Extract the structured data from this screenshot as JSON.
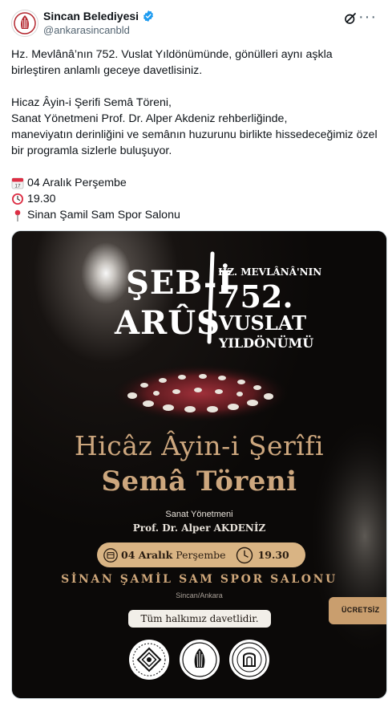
{
  "account": {
    "name": "Sincan Belediyesi",
    "handle": "@ankarasincanbld",
    "verified": true
  },
  "header_icons": [
    "verified-badge-icon",
    "grok-icon",
    "more-icon"
  ],
  "tweet": {
    "paragraph1": [
      "Hz. Mevlânâ’nın 752. Vuslat Yıldönümünde, gönülleri aynı aşkla",
      "birleştiren anlamlı geceye davetlisiniz."
    ],
    "paragraph2": [
      "Hicaz Âyin-i Şerifi Semâ Töreni,",
      "Sanat Yönetmeni Prof. Dr. Alper Akdeniz rehberliğinde,",
      "maneviyatın derinliğini ve semânın huzurunu birlikte hissedeceğimiz özel",
      "bir programla sizlerle buluşuyor."
    ],
    "date_line": "04 Aralık Perşembe",
    "time_line": "19.30",
    "place_line": "Sinan Şamil Sam Spor Salonu",
    "emoji_icons": [
      "calendar-icon",
      "clock-icon",
      "pin-icon"
    ]
  },
  "poster": {
    "seb": "ŞEB-İ",
    "arus": "ARÛS",
    "hz": "HZ. MEVLÂNÂ'NIN",
    "number": "752.",
    "vuslat": "VUSLAT",
    "yildonumu": "YILDÖNÜMÜ",
    "title": "Hicâz Âyin-i Şerîfi",
    "subtitle": "Semâ Töreni",
    "director_label": "Sanat Yönetmeni",
    "director_name": "Prof. Dr. Alper AKDENİZ",
    "date_bold": "04 Aralık",
    "date_rest": "Perşembe",
    "time": "19.30",
    "venue": "SİNAN ŞAMİL SAM SPOR SALONU",
    "city": "Sincan/Ankara",
    "invite": "Tüm halkımız davetlidir.",
    "free": "ÜCRETSİZ",
    "logos": [
      "culture-ministry-logo",
      "sincan-municipality-logo",
      "ayby-university-logo"
    ],
    "colors": {
      "gold": "#cda77e",
      "bar": "#d9b484",
      "background": "#0b0908",
      "verified": "#1d9bf0"
    }
  }
}
